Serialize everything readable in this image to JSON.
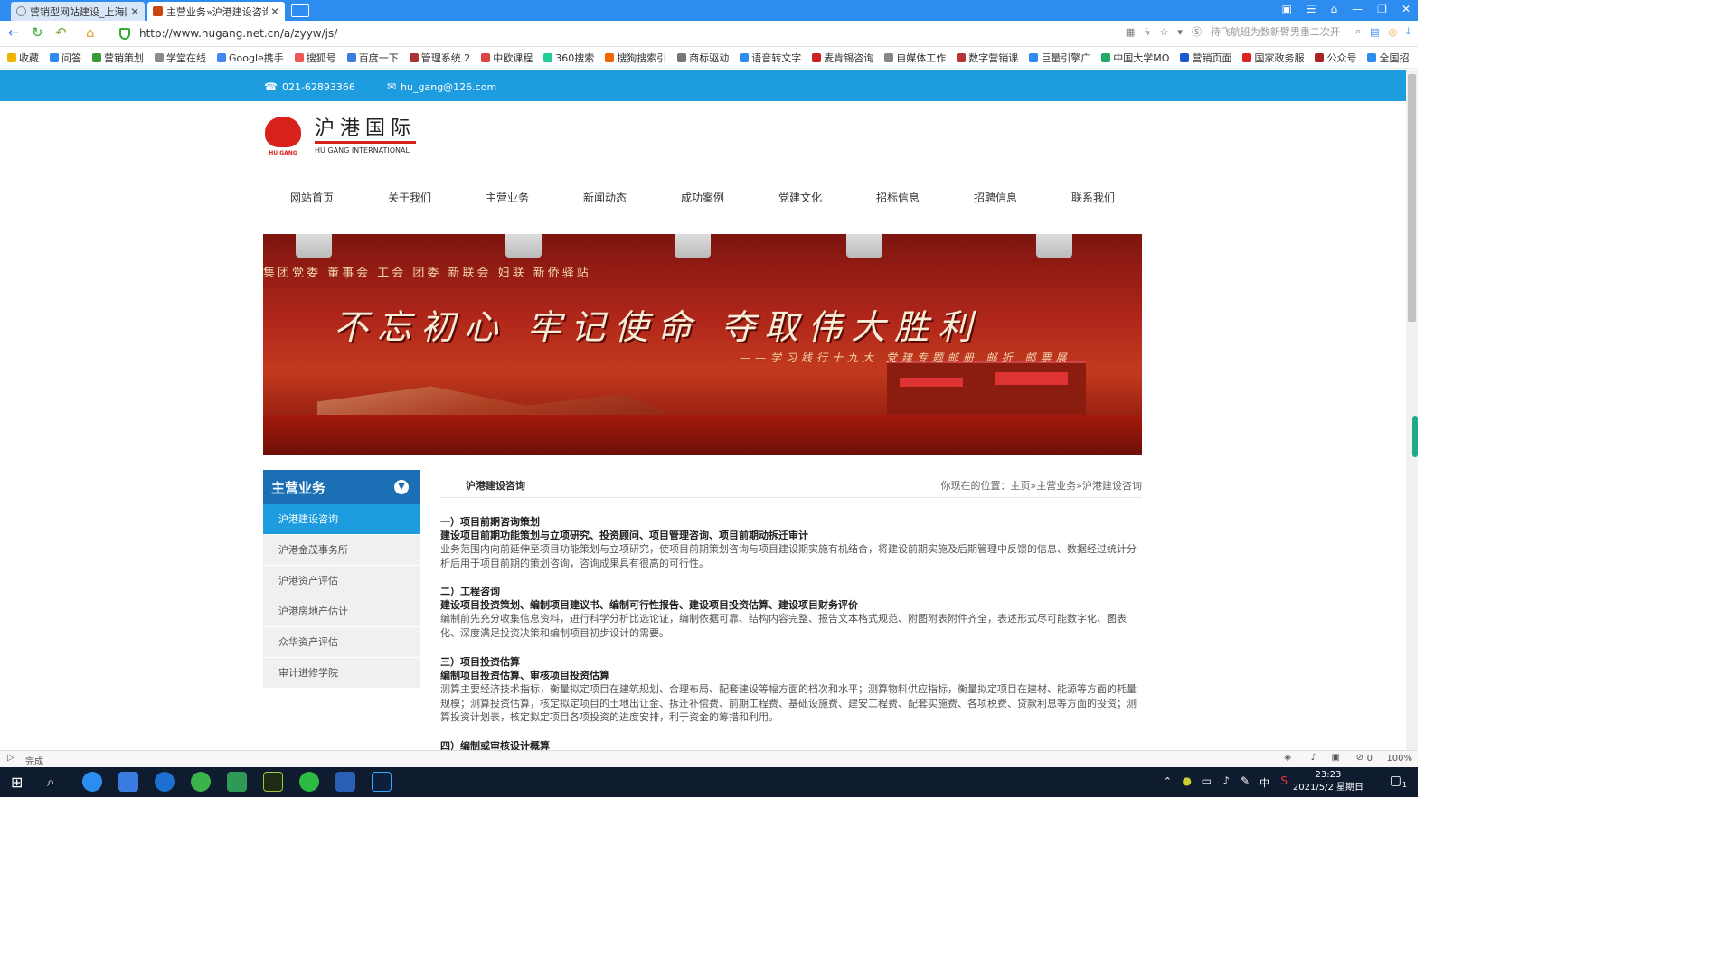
{
  "browser": {
    "tabs": [
      {
        "title": "营销型网站建设_上海网站",
        "active": false
      },
      {
        "title": "主营业务»沪港建设咨询",
        "active": true
      }
    ],
    "url": "http://www.hugang.net.cn/a/zyyw/js/",
    "search_placeholder": "待飞航班为数新臂男重二次开",
    "bookmarks": [
      "收藏",
      "问答",
      "营销策划",
      "学堂在线",
      "Google携手",
      "搜狐号",
      "百度一下",
      "管理系统 2",
      "中欧课程",
      "360搜索",
      "搜狗搜索引",
      "商标驱动",
      "语音转文字",
      "麦肯锡咨询",
      "自媒体工作",
      "数字营销课",
      "巨量引擎广",
      "中国大学MO",
      "营销页面",
      "国家政务服",
      "公众号",
      "全国招"
    ],
    "status": "完成",
    "zoom": "100%",
    "status_counter": "0"
  },
  "site": {
    "phone": "021-62893366",
    "email": "hu_gang@126.com",
    "logo_cn": "沪港国际",
    "logo_en": "HU GANG INTERNATIONAL",
    "logo_mark_caption": "HU GANG",
    "nav": [
      "网站首页",
      "关于我们",
      "主营业务",
      "新闻动态",
      "成功案例",
      "党建文化",
      "招标信息",
      "招聘信息",
      "联系我们"
    ],
    "banner": {
      "top": "集团党委 董事会 工会 团委 新联会 妇联 新侨驿站",
      "main": "不忘初心  牢记使命  夺取伟大胜利",
      "sub": "——学习践行十九大 党建专题邮册 邮折 邮票展"
    },
    "sidebar": {
      "title": "主营业务",
      "items": [
        "沪港建设咨询",
        "沪港金茂事务所",
        "沪港资产评估",
        "沪港房地产估计",
        "众华资产评估",
        "审计进修学院"
      ]
    },
    "content": {
      "title": "沪港建设咨询",
      "breadcrumb": "你现在的位置：主页»主营业务»沪港建设咨询",
      "sections": [
        {
          "heading": "一）项目前期咨询策划",
          "subheading": "建设项目前期功能策划与立项研究、投资顾问、项目管理咨询、项目前期动拆迁审计",
          "body": "业务范围内向前延伸至项目功能策划与立项研究，使项目前期策划咨询与项目建设期实施有机结合，将建设前期实施及后期管理中反馈的信息、数据经过统计分析后用于项目前期的策划咨询，咨询成果具有很高的可行性。"
        },
        {
          "heading": "二）工程咨询",
          "subheading": "建设项目投资策划、编制项目建议书、编制可行性报告、建设项目投资估算、建设项目财务评价",
          "body": "编制前先充分收集信息资料，进行科学分析比选论证，编制依据可靠、结构内容完整、报告文本格式规范、附图附表附件齐全，表述形式尽可能数字化、图表化、深度满足投资决策和编制项目初步设计的需要。"
        },
        {
          "heading": "三）项目投资估算",
          "subheading": "编制项目投资估算、审核项目投资估算",
          "body": "测算主要经济技术指标，衡量拟定项目在建筑规划、合理布局、配套建设等幅方面的档次和水平；测算物料供应指标，衡量拟定项目在建材、能源等方面的耗量规模；测算投资估算，核定拟定项目的土地出让金、拆迁补偿费、前期工程费、基础设施费、建安工程费、配套实施费、各项税费、贷款利息等方面的投资；测算投资计划表，核定拟定项目各项投资的进度安排，利于资金的筹措和利用。"
        },
        {
          "heading": "四）编制或审核设计概算",
          "subheading": "",
          "body": ""
        }
      ]
    }
  },
  "taskbar": {
    "time": "23:23",
    "date": "2021/5/2 星期日",
    "ime": "中",
    "notification_count": "1"
  },
  "colors": {
    "accent": "#1e9ce0",
    "brand_red": "#d9211b",
    "sidebar_head": "#1b6fb4"
  }
}
